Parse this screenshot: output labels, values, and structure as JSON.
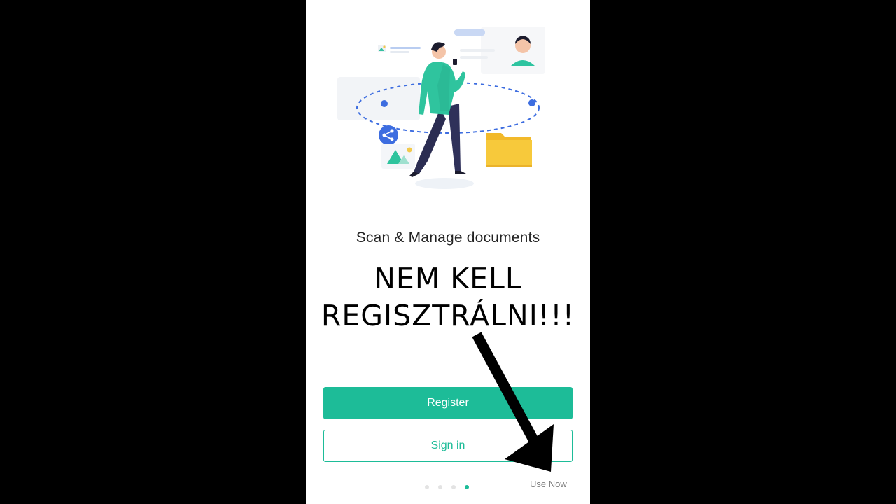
{
  "onboarding": {
    "headline": "Scan & Manage documents",
    "overlay_line1": "NEM KELL",
    "overlay_line2": "REGISZTRÁLNI!!!",
    "register_label": "Register",
    "signin_label": "Sign in",
    "use_now_label": "Use Now",
    "pager": {
      "total": 4,
      "active_index": 3
    }
  },
  "colors": {
    "accent": "#1dbc98",
    "background": "#ffffff",
    "letterbox": "#000000",
    "orbit": "#3d6de0",
    "folder": "#f7c93b"
  },
  "icons": [
    "share-icon",
    "image-icon",
    "folder-icon",
    "avatar-icon"
  ]
}
